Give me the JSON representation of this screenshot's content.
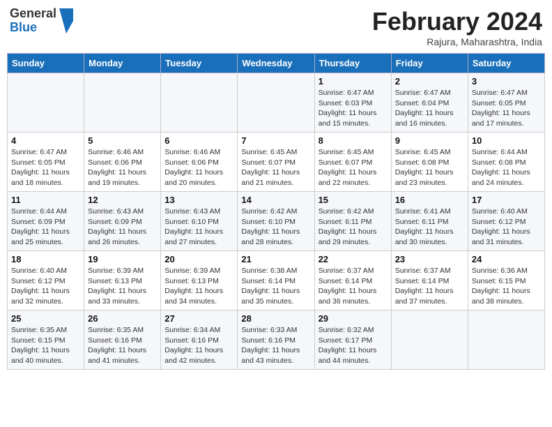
{
  "header": {
    "logo_general": "General",
    "logo_blue": "Blue",
    "title": "February 2024",
    "location": "Rajura, Maharashtra, India"
  },
  "days_of_week": [
    "Sunday",
    "Monday",
    "Tuesday",
    "Wednesday",
    "Thursday",
    "Friday",
    "Saturday"
  ],
  "weeks": [
    [
      {
        "day": "",
        "info": ""
      },
      {
        "day": "",
        "info": ""
      },
      {
        "day": "",
        "info": ""
      },
      {
        "day": "",
        "info": ""
      },
      {
        "day": "1",
        "info": "Sunrise: 6:47 AM\nSunset: 6:03 PM\nDaylight: 11 hours and 15 minutes."
      },
      {
        "day": "2",
        "info": "Sunrise: 6:47 AM\nSunset: 6:04 PM\nDaylight: 11 hours and 16 minutes."
      },
      {
        "day": "3",
        "info": "Sunrise: 6:47 AM\nSunset: 6:05 PM\nDaylight: 11 hours and 17 minutes."
      }
    ],
    [
      {
        "day": "4",
        "info": "Sunrise: 6:47 AM\nSunset: 6:05 PM\nDaylight: 11 hours and 18 minutes."
      },
      {
        "day": "5",
        "info": "Sunrise: 6:46 AM\nSunset: 6:06 PM\nDaylight: 11 hours and 19 minutes."
      },
      {
        "day": "6",
        "info": "Sunrise: 6:46 AM\nSunset: 6:06 PM\nDaylight: 11 hours and 20 minutes."
      },
      {
        "day": "7",
        "info": "Sunrise: 6:45 AM\nSunset: 6:07 PM\nDaylight: 11 hours and 21 minutes."
      },
      {
        "day": "8",
        "info": "Sunrise: 6:45 AM\nSunset: 6:07 PM\nDaylight: 11 hours and 22 minutes."
      },
      {
        "day": "9",
        "info": "Sunrise: 6:45 AM\nSunset: 6:08 PM\nDaylight: 11 hours and 23 minutes."
      },
      {
        "day": "10",
        "info": "Sunrise: 6:44 AM\nSunset: 6:08 PM\nDaylight: 11 hours and 24 minutes."
      }
    ],
    [
      {
        "day": "11",
        "info": "Sunrise: 6:44 AM\nSunset: 6:09 PM\nDaylight: 11 hours and 25 minutes."
      },
      {
        "day": "12",
        "info": "Sunrise: 6:43 AM\nSunset: 6:09 PM\nDaylight: 11 hours and 26 minutes."
      },
      {
        "day": "13",
        "info": "Sunrise: 6:43 AM\nSunset: 6:10 PM\nDaylight: 11 hours and 27 minutes."
      },
      {
        "day": "14",
        "info": "Sunrise: 6:42 AM\nSunset: 6:10 PM\nDaylight: 11 hours and 28 minutes."
      },
      {
        "day": "15",
        "info": "Sunrise: 6:42 AM\nSunset: 6:11 PM\nDaylight: 11 hours and 29 minutes."
      },
      {
        "day": "16",
        "info": "Sunrise: 6:41 AM\nSunset: 6:11 PM\nDaylight: 11 hours and 30 minutes."
      },
      {
        "day": "17",
        "info": "Sunrise: 6:40 AM\nSunset: 6:12 PM\nDaylight: 11 hours and 31 minutes."
      }
    ],
    [
      {
        "day": "18",
        "info": "Sunrise: 6:40 AM\nSunset: 6:12 PM\nDaylight: 11 hours and 32 minutes."
      },
      {
        "day": "19",
        "info": "Sunrise: 6:39 AM\nSunset: 6:13 PM\nDaylight: 11 hours and 33 minutes."
      },
      {
        "day": "20",
        "info": "Sunrise: 6:39 AM\nSunset: 6:13 PM\nDaylight: 11 hours and 34 minutes."
      },
      {
        "day": "21",
        "info": "Sunrise: 6:38 AM\nSunset: 6:14 PM\nDaylight: 11 hours and 35 minutes."
      },
      {
        "day": "22",
        "info": "Sunrise: 6:37 AM\nSunset: 6:14 PM\nDaylight: 11 hours and 36 minutes."
      },
      {
        "day": "23",
        "info": "Sunrise: 6:37 AM\nSunset: 6:14 PM\nDaylight: 11 hours and 37 minutes."
      },
      {
        "day": "24",
        "info": "Sunrise: 6:36 AM\nSunset: 6:15 PM\nDaylight: 11 hours and 38 minutes."
      }
    ],
    [
      {
        "day": "25",
        "info": "Sunrise: 6:35 AM\nSunset: 6:15 PM\nDaylight: 11 hours and 40 minutes."
      },
      {
        "day": "26",
        "info": "Sunrise: 6:35 AM\nSunset: 6:16 PM\nDaylight: 11 hours and 41 minutes."
      },
      {
        "day": "27",
        "info": "Sunrise: 6:34 AM\nSunset: 6:16 PM\nDaylight: 11 hours and 42 minutes."
      },
      {
        "day": "28",
        "info": "Sunrise: 6:33 AM\nSunset: 6:16 PM\nDaylight: 11 hours and 43 minutes."
      },
      {
        "day": "29",
        "info": "Sunrise: 6:32 AM\nSunset: 6:17 PM\nDaylight: 11 hours and 44 minutes."
      },
      {
        "day": "",
        "info": ""
      },
      {
        "day": "",
        "info": ""
      }
    ]
  ]
}
